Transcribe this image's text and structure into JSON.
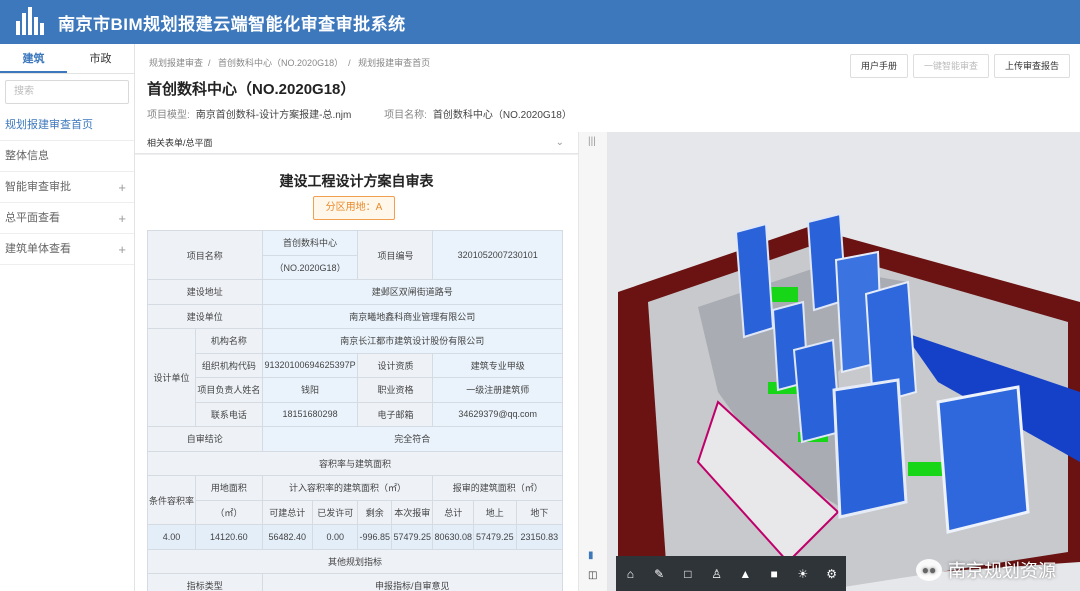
{
  "app": {
    "title": "南京市BIM规划报建云端智能化审查审批系统"
  },
  "sidebar": {
    "tabs": [
      "建筑",
      "市政"
    ],
    "search_placeholder": "搜索",
    "items": [
      {
        "label": "规划报建审查首页"
      },
      {
        "label": "整体信息"
      },
      {
        "label": "智能审查审批"
      },
      {
        "label": "总平面查看"
      },
      {
        "label": "建筑单体查看"
      }
    ]
  },
  "breadcrumb": [
    "规划报建审查",
    "首创数科中心（NO.2020G18）",
    "规划报建审查首页"
  ],
  "buttons": {
    "manual": "用户手册",
    "smart_review": "一键智能审查",
    "upload_report": "上传审查报告"
  },
  "project": {
    "title": "首创数科中心（NO.2020G18）",
    "model_label": "项目模型:",
    "model_value": "南京首创数科-设计方案报建-总.njm",
    "name_label": "项目名称:",
    "name_value": "首创数科中心（NO.2020G18）"
  },
  "panel": {
    "header": "相关表单/总平面"
  },
  "form": {
    "title": "建设工程设计方案自审表",
    "zone_tag": "分区用地：A",
    "rows": {
      "project_name_label": "项目名称",
      "project_name_value_1": "首创数科中心",
      "project_name_value_2": "（NO.2020G18）",
      "project_no_label": "项目编号",
      "project_no_value": "3201052007230101",
      "address_label": "建设地址",
      "address_value": "建邺区双闸街道路号",
      "builder_label": "建设单位",
      "builder_value": "南京曦地鑫科商业管理有限公司",
      "design_unit_label": "设计单位",
      "org_name_label": "机构名称",
      "org_name_value": "南京长江都市建筑设计股份有限公司",
      "org_code_label": "组织机构代码",
      "org_code_value": "91320100694625397P",
      "qual_label": "设计资质",
      "qual_value": "建筑专业甲级",
      "leader_label": "项目负责人姓名",
      "leader_value": "钱阳",
      "title_label": "职业资格",
      "title_value": "一级注册建筑师",
      "phone_label": "联系电话",
      "phone_value": "18151680298",
      "email_label": "电子邮箱",
      "email_value": "34629379@qq.com",
      "conclusion_label": "自审结论",
      "conclusion_value": "完全符合",
      "far_section": "容积率与建筑面积",
      "cond_far": "条件容积率",
      "land_area": "用地面积",
      "land_area_unit": "（㎡）",
      "far_area_head": "计入容积率的建筑面积（㎡）",
      "report_area_head": "报审的建筑面积（㎡）",
      "sub_cols": [
        "可建总计",
        "已发许可",
        "剩余",
        "本次报审",
        "总计",
        "地上",
        "地下"
      ],
      "values": [
        "4.00",
        "14120.60",
        "56482.40",
        "0.00",
        "-996.85",
        "57479.25",
        "80630.08",
        "57479.25",
        "23150.83"
      ],
      "other_section": "其他规划指标",
      "index_type": "指标类型",
      "index_value": "申报指标/自审意见"
    }
  },
  "toolbar3d": [
    "home-icon",
    "measure-icon",
    "section-box-icon",
    "person-icon",
    "tree-icon",
    "layer-icon",
    "sun-icon",
    "settings-icon"
  ],
  "watermark": "南京规划资源",
  "colors": {
    "header": "#3d78bd",
    "accent": "#3d78bd",
    "tag": "#e98a2b"
  }
}
